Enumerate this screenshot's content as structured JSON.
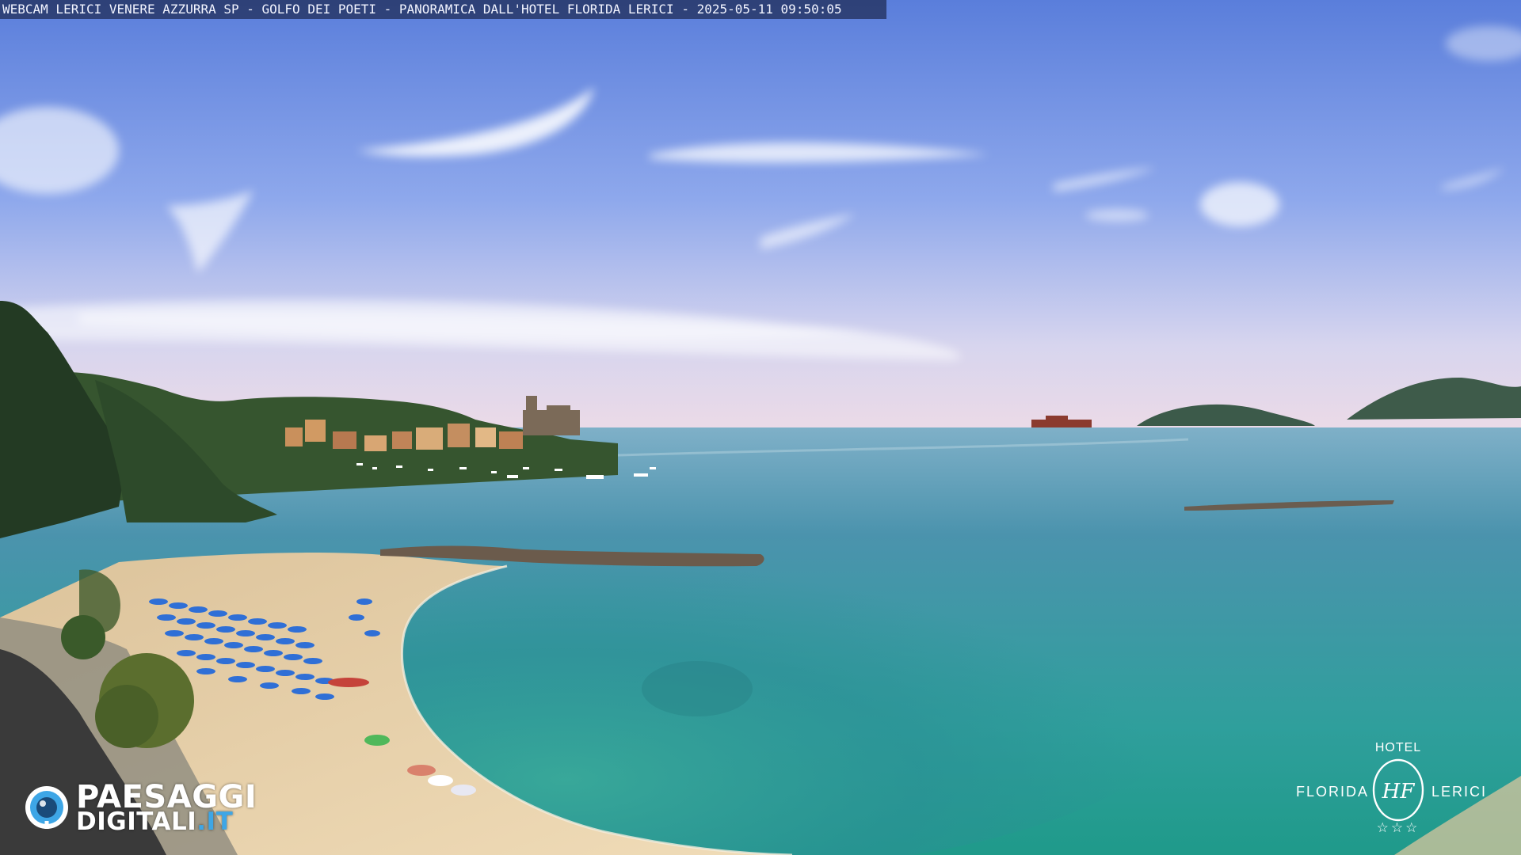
{
  "caption": {
    "text": "WEBCAM LERICI VENERE AZZURRA SP - GOLFO DEI POETI - PANORAMICA DALL'HOTEL FLORIDA LERICI - 2025-05-11 09:50:05"
  },
  "watermark": {
    "line1": "PAESAGGI",
    "line2_main": "DIGITALI",
    "line2_suffix": ".IT",
    "badge_icon": "camera-lens-icon",
    "accent_color": "#3ea6e6"
  },
  "hotel_logo": {
    "top_word": "HOTEL",
    "left_word": "FLORIDA",
    "right_word": "LERICI",
    "monogram": "HF",
    "stars": "☆☆☆"
  },
  "scene": {
    "subjects": [
      "sky",
      "clouds",
      "sea",
      "beach",
      "breakwater",
      "castle",
      "town",
      "hills",
      "islands",
      "promontory",
      "umbrellas",
      "boats",
      "road"
    ],
    "colors": {
      "sky_top": "#5b7fdc",
      "sky_horizon": "#e8d9e6",
      "sea_far": "#4f93b3",
      "sea_near": "#2aa49a",
      "sand": "#e9d4ae",
      "vegetation": "#2f4a2a",
      "umbrella_blue": "#2f6fd6"
    }
  }
}
